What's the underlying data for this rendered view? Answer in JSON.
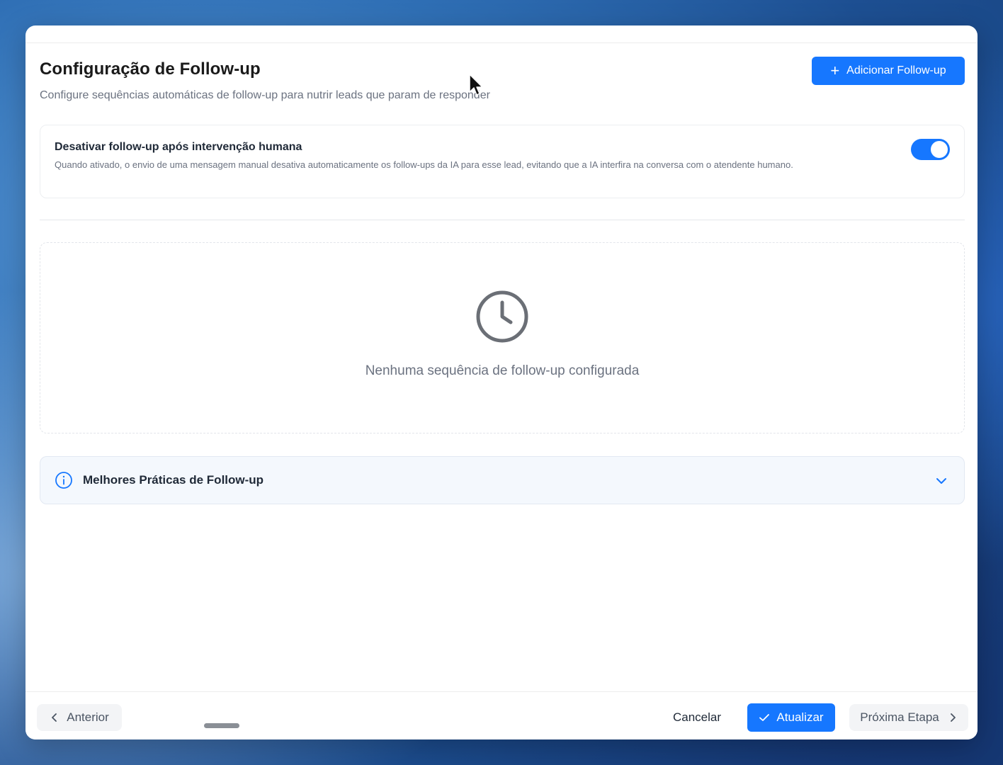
{
  "header": {
    "title": "Configuração de Follow-up",
    "subtitle": "Configure sequências automáticas de follow-up para nutrir leads que param de responder",
    "add_button_label": "Adicionar Follow-up"
  },
  "human_intervention": {
    "title": "Desativar follow-up após intervenção humana",
    "description": "Quando ativado, o envio de uma mensagem manual desativa automaticamente os follow-ups da IA para esse lead, evitando que a IA interfira na conversa com o atendente humano.",
    "enabled": true
  },
  "empty_state": {
    "icon": "clock-icon",
    "text": "Nenhuma sequência de follow-up configurada"
  },
  "best_practices": {
    "icon": "info-icon",
    "title": "Melhores Práticas de Follow-up",
    "expanded": false
  },
  "footer": {
    "previous_label": "Anterior",
    "cancel_label": "Cancelar",
    "update_label": "Atualizar",
    "next_label": "Próxima Etapa"
  },
  "colors": {
    "primary": "#1677ff",
    "text_muted": "#6b7280"
  }
}
